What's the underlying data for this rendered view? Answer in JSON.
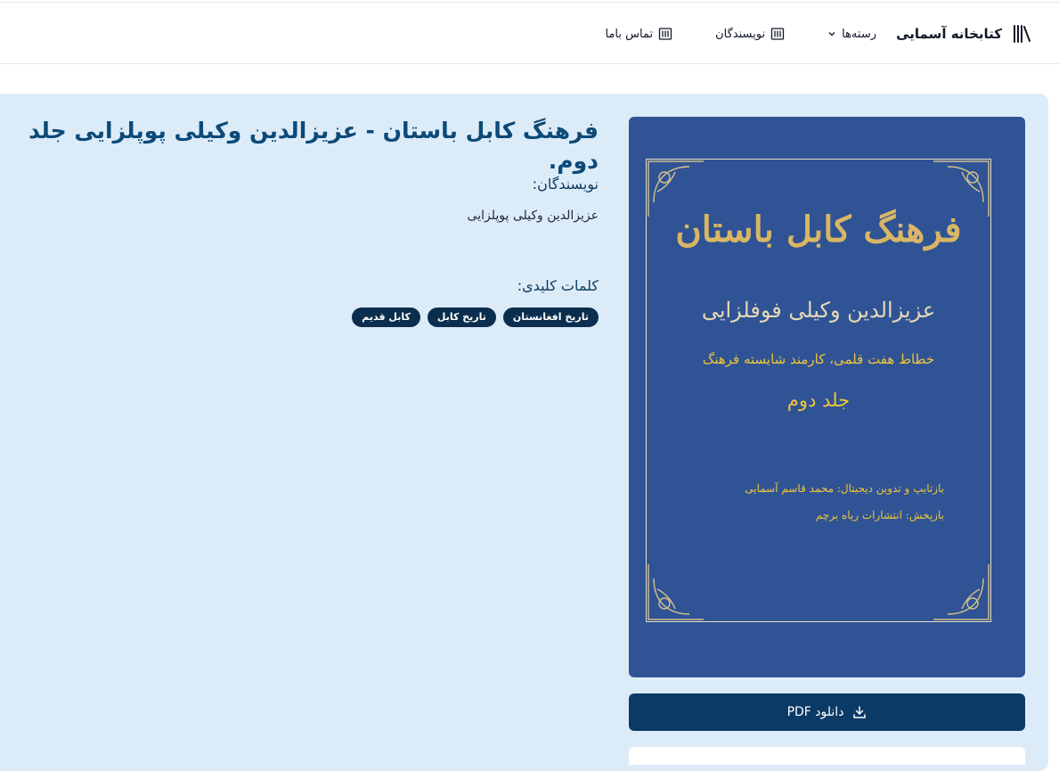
{
  "header": {
    "brand": "کتابخانه آسمایی",
    "nav": {
      "categories": "رسته‌ها",
      "authors": "نویسندگان",
      "contact": "تماس باما"
    }
  },
  "book": {
    "title": "فرهنگ کابل باستان - عزیزالدین وکیلی پوپلزایی جلد دوم.",
    "authors_label": "نویسندگان:",
    "author": "عزیزالدین وکیلی پوپلزایی",
    "keywords_label": "کلمات کلیدی:",
    "keywords": [
      "تاریخ افغانستان",
      "تاریخ کابل",
      "کابل قدیم"
    ]
  },
  "cover": {
    "title": "فرهنگ کابل باستان",
    "author": "عزیزالدین وکیلی فوفلزایی",
    "calligrapher": "خطاط هفت قلمی، کارمند شایسته فرهنگ",
    "volume": "جلد دوم",
    "reprint": "بازتایپ و تدوین دیجیتال: محمد قاسم آسمایی",
    "publisher": "بازپخش: انتشارات ریاه برچم"
  },
  "actions": {
    "download_label": "دانلود PDF"
  },
  "colors": {
    "panel": "#dcebf8",
    "title": "#0b4a78",
    "button": "#0c3a67",
    "cover": "#2f5395",
    "cover_gold": "#f0c53a"
  }
}
